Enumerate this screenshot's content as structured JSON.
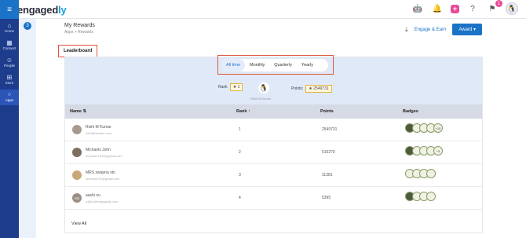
{
  "brand": {
    "prefix": "engaged",
    "suffix": "ly"
  },
  "topbar": {
    "notifications_count": "1",
    "icons": [
      "bell-icon",
      "plus-icon",
      "help-icon",
      "flag-icon",
      "avatar"
    ]
  },
  "sidebar": {
    "items": [
      {
        "label": "Home",
        "icon": "home-icon"
      },
      {
        "label": "Connect",
        "icon": "connect-icon"
      },
      {
        "label": "People",
        "icon": "people-icon"
      },
      {
        "label": "Store",
        "icon": "cart-icon"
      },
      {
        "label": "Apps",
        "icon": "apps-icon"
      }
    ]
  },
  "step": {
    "number": "3"
  },
  "header": {
    "title": "My Rewards",
    "breadcrumb": "Apps  >  Rewards",
    "engage_label": "Engage & Earn",
    "award_label": "Award"
  },
  "leaderboard": {
    "title": "Leaderboard",
    "periods": [
      "All time",
      "Monthly",
      "Quarterly",
      "Yearly"
    ],
    "active_period": "All time",
    "rank_label": "Rank",
    "my_rank": "1",
    "my_name": "Rishi M Kumar",
    "points_label": "Points:",
    "my_points": "2549731",
    "columns": {
      "name": "Name",
      "rank": "Rank",
      "points": "Points",
      "badges": "Badges"
    },
    "rows": [
      {
        "name": "Rishi M Kumar",
        "email": "rishi@domain.com",
        "rank": "1",
        "points": "2549731",
        "initials": "",
        "more": "+10"
      },
      {
        "name": "Michaels John",
        "email": "mrpower1232@gmail.com",
        "rank": "2",
        "points": "510270",
        "initials": "",
        "more": "+3"
      },
      {
        "name": "MRS swapna stn",
        "email": "stnhana122@gmail.com",
        "rank": "3",
        "points": "11381",
        "initials": "",
        "more": ""
      },
      {
        "name": "aashi ou",
        "email": "k@hu@engagedly.com",
        "rank": "4",
        "points": "5395",
        "initials": "AS",
        "more": ""
      }
    ],
    "view_all": "View All"
  }
}
